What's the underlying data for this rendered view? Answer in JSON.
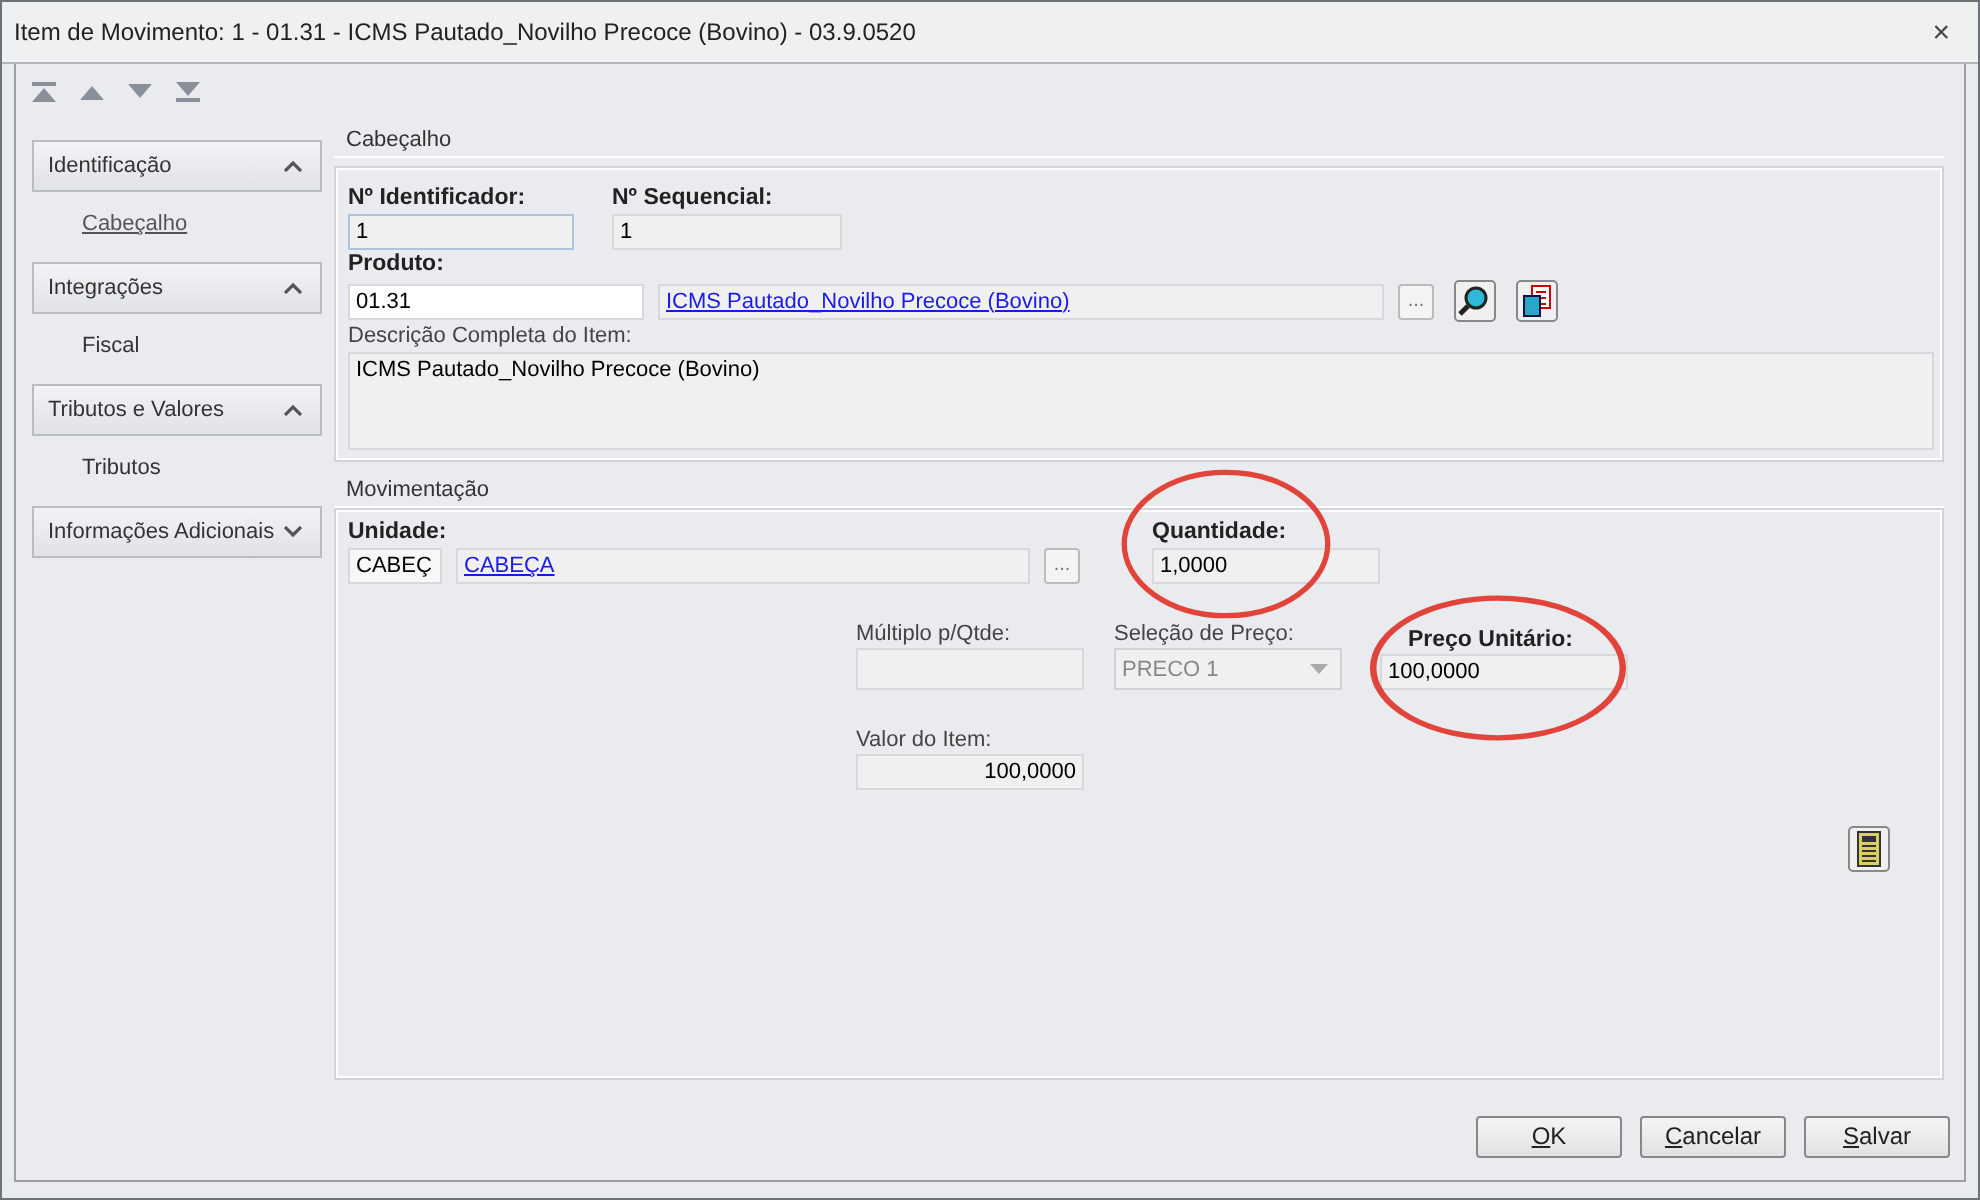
{
  "window": {
    "title": "Item de Movimento: 1 - 01.31 - ICMS Pautado_Novilho Precoce (Bovino) - 03.9.0520",
    "close": "×"
  },
  "sidebar": {
    "sections": [
      {
        "title": "Identificação",
        "expanded": true,
        "items": [
          {
            "label": "Cabeçalho",
            "selected": true
          }
        ]
      },
      {
        "title": "Integrações",
        "expanded": true,
        "items": [
          {
            "label": "Fiscal",
            "selected": false
          }
        ]
      },
      {
        "title": "Tributos e Valores",
        "expanded": true,
        "items": [
          {
            "label": "Tributos",
            "selected": false
          }
        ]
      },
      {
        "title": "Informações Adicionais",
        "expanded": false
      }
    ]
  },
  "cabecalho": {
    "title": "Cabeçalho",
    "identificador": {
      "label": "Nº Identificador:",
      "value": "1"
    },
    "sequencial": {
      "label": "Nº Sequencial:",
      "value": "1"
    },
    "produto": {
      "label": "Produto:",
      "code": "01.31",
      "link": "ICMS Pautado_Novilho Precoce (Bovino)",
      "browse": "..."
    },
    "descricao": {
      "label": "Descrição Completa do Item:",
      "value": "ICMS Pautado_Novilho Precoce (Bovino)"
    }
  },
  "movimentacao": {
    "title": "Movimentação",
    "unidade": {
      "label": "Unidade:",
      "code": "CABEÇ",
      "link": "CABEÇA",
      "browse": "..."
    },
    "quantidade": {
      "label": "Quantidade:",
      "value": "1,0000",
      "circled": true
    },
    "multiplo": {
      "label": "Múltiplo p/Qtde:"
    },
    "selecao": {
      "label": "Seleção de Preço:",
      "value": "PRECO 1",
      "disabled": true
    },
    "preco": {
      "label": "Preço Unitário:",
      "value": "100,0000",
      "circled": true
    },
    "valor": {
      "label": "Valor do Item:",
      "value": "100,0000"
    }
  },
  "buttons": [
    {
      "label": "OK"
    },
    {
      "label": "Cancelar"
    },
    {
      "label": "Salvar"
    }
  ]
}
